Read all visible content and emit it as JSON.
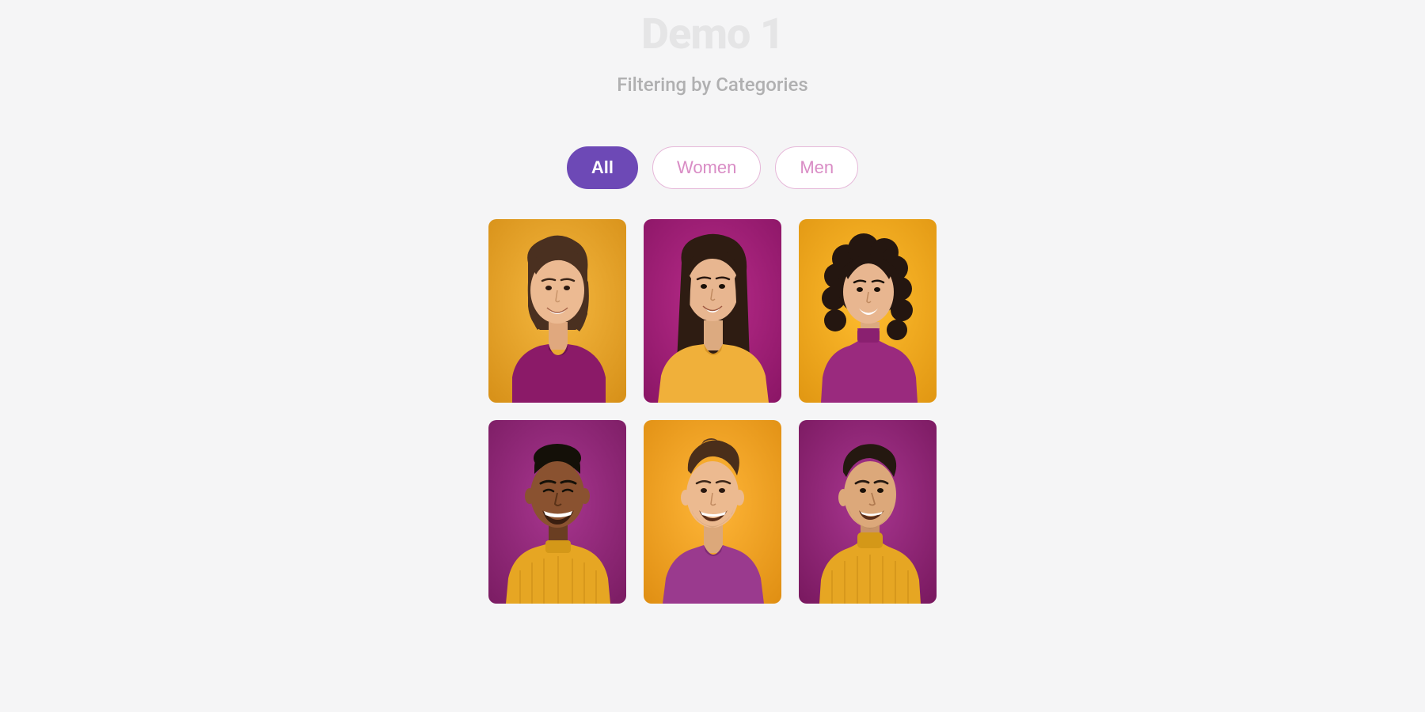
{
  "header": {
    "title": "Demo 1",
    "subtitle": "Filtering by Categories"
  },
  "filters": {
    "items": [
      {
        "label": "All",
        "active": true
      },
      {
        "label": "Women",
        "active": false
      },
      {
        "label": "Men",
        "active": false
      }
    ]
  },
  "gallery": {
    "items": [
      {
        "name": "portrait-woman-1",
        "bg": "#e6a623",
        "shirt": "#8b1a68",
        "skin": "#e8b892",
        "hair": "#3a2518"
      },
      {
        "name": "portrait-woman-2",
        "bg": "#a51f7a",
        "shirt": "#f0b03a",
        "skin": "#e6b088",
        "hair": "#3a2518"
      },
      {
        "name": "portrait-woman-3",
        "bg": "#f2ab1c",
        "shirt": "#9a2a7e",
        "skin": "#e6b088",
        "hair": "#2a1810"
      },
      {
        "name": "portrait-man-1",
        "bg": "#9a2a7e",
        "shirt": "#e6a623",
        "skin": "#7a4a2a",
        "hair": "#1a1008"
      },
      {
        "name": "portrait-man-2",
        "bg": "#f0a020",
        "shirt": "#9a3a8e",
        "skin": "#e6b088",
        "hair": "#4a2e1a"
      },
      {
        "name": "portrait-man-3",
        "bg": "#9a2a7e",
        "shirt": "#e6a623",
        "skin": "#d8a47a",
        "hair": "#2a1810"
      }
    ]
  }
}
